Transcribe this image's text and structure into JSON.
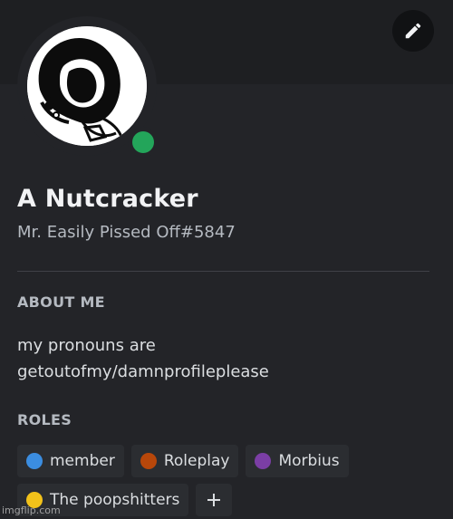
{
  "profile": {
    "display_name": "A Nutcracker",
    "username": "Mr. Easily Pissed Off#5847",
    "status_color": "#23a55a",
    "avatar_icon": "cartoon-face-avatar"
  },
  "about": {
    "title": "ABOUT ME",
    "lines": [
      "my pronouns are",
      "getoutofmy/damnprofileplease"
    ]
  },
  "roles": {
    "title": "ROLES",
    "items": [
      {
        "label": "member",
        "color": "#3b8de0"
      },
      {
        "label": "Roleplay",
        "color": "#b8470a"
      },
      {
        "label": "Morbius",
        "color": "#7b3ea5"
      },
      {
        "label": "The poopshitters",
        "color": "#f2c21a"
      }
    ],
    "add_icon": "plus-icon"
  },
  "toolbar": {
    "edit_icon": "pencil-icon"
  },
  "watermark": "imgflip.com",
  "theme": {
    "background": "#232428",
    "banner": "#1e1f22",
    "pill": "#2b2d31"
  }
}
